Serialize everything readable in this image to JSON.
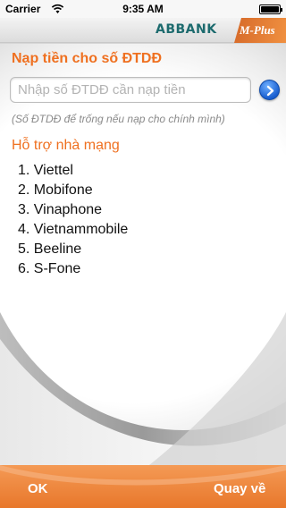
{
  "status_bar": {
    "carrier": "Carrier",
    "time": "9:35 AM"
  },
  "brand": {
    "logo_text": "ABBANK",
    "product_text": "M-Plus"
  },
  "form": {
    "title": "Nạp tiền cho số ĐTDĐ",
    "phone_placeholder": "Nhập số ĐTDĐ cần nạp tiền",
    "phone_value": "",
    "hint": "(Số ĐTDĐ để trống nếu nạp cho chính mình)"
  },
  "carriers": {
    "heading": "Hỗ trợ nhà mạng",
    "items": [
      "1. Viettel",
      "2. Mobifone",
      "3. Vinaphone",
      "4. Vietnammobile",
      "5. Beeline",
      "6. S-Fone"
    ]
  },
  "footer": {
    "ok_label": "OK",
    "back_label": "Quay về"
  },
  "colors": {
    "accent_orange": "#ef7020",
    "brand_teal": "#1d6b6e",
    "button_blue": "#1a5fd0"
  }
}
